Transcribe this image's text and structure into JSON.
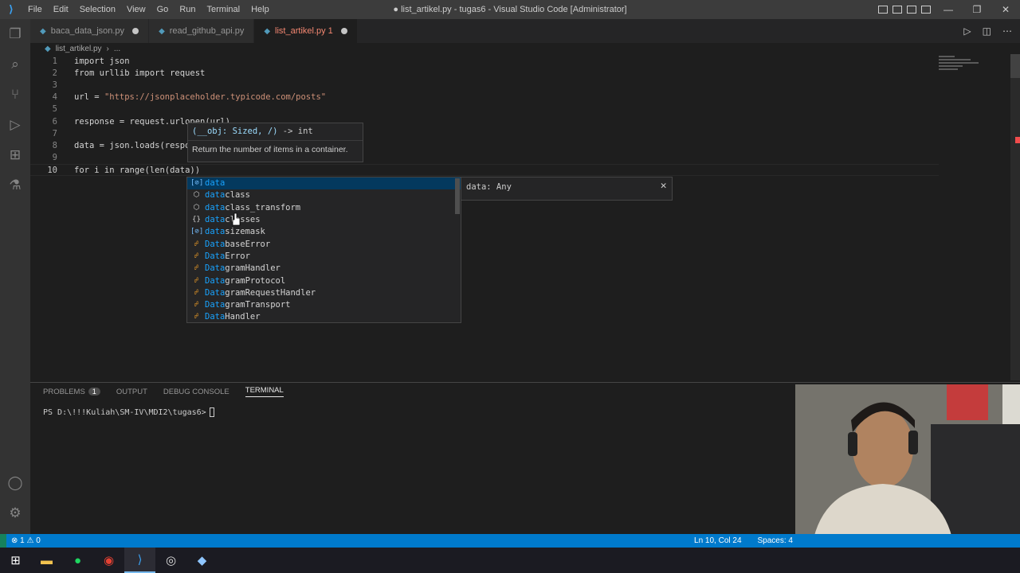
{
  "menu": [
    "File",
    "Edit",
    "Selection",
    "View",
    "Go",
    "Run",
    "Terminal",
    "Help"
  ],
  "window_title": "● list_artikel.py - tugas6 - Visual Studio Code [Administrator]",
  "tabs": [
    {
      "label": "baca_data_json.py"
    },
    {
      "label": "read_github_api.py"
    },
    {
      "label": "list_artikel.py 1"
    }
  ],
  "breadcrumb": {
    "file": "list_artikel.py",
    "more": "..."
  },
  "code_lines": [
    {
      "n": "1",
      "text": "import json"
    },
    {
      "n": "2",
      "text": "from urllib import request"
    },
    {
      "n": "3",
      "text": ""
    },
    {
      "n": "4",
      "pre": "url = ",
      "str": "\"https://jsonplaceholder.typicode.com/posts\""
    },
    {
      "n": "5",
      "text": ""
    },
    {
      "n": "6",
      "text": "response = request.urlopen(url)"
    },
    {
      "n": "7",
      "text": ""
    },
    {
      "n": "8",
      "text": "data = json.loads(respo"
    },
    {
      "n": "9",
      "text": ""
    },
    {
      "n": "10",
      "text": "for i in range(len(data))"
    }
  ],
  "hover": {
    "signature_param": "(__obj: Sized, /)",
    "signature_ret": " -> int",
    "doc": "Return the number of items in a container."
  },
  "suggestions": [
    {
      "kind": "var",
      "match": "data",
      "rest": ""
    },
    {
      "kind": "mod",
      "match": "data",
      "rest": "class"
    },
    {
      "kind": "mod",
      "match": "data",
      "rest": "class_transform"
    },
    {
      "kind": "ns",
      "match": "data",
      "rest": "classes"
    },
    {
      "kind": "var",
      "match": "data",
      "rest": "sizemask"
    },
    {
      "kind": "cls",
      "match": "Data",
      "rest": "baseError"
    },
    {
      "kind": "cls",
      "match": "Data",
      "rest": "Error"
    },
    {
      "kind": "cls",
      "match": "Data",
      "rest": "gramHandler"
    },
    {
      "kind": "cls",
      "match": "Data",
      "rest": "gramProtocol"
    },
    {
      "kind": "cls",
      "match": "Data",
      "rest": "gramRequestHandler"
    },
    {
      "kind": "cls",
      "match": "Data",
      "rest": "gramTransport"
    },
    {
      "kind": "cls",
      "match": "Data",
      "rest": "Handler"
    }
  ],
  "details": {
    "text": "data: Any",
    "close": "✕"
  },
  "panel": {
    "tabs": [
      "PROBLEMS",
      "OUTPUT",
      "DEBUG CONSOLE",
      "TERMINAL"
    ],
    "problems_count": "1",
    "prompt": "PS D:\\!!!Kuliah\\SM-IV\\MDI2\\tugas6>"
  },
  "status": {
    "problems": "⊗ 1  ⚠ 0",
    "position": "Ln 10, Col 24",
    "spaces": "Spaces: 4"
  },
  "colors": {
    "accent": "#007acc",
    "selection": "#04395e",
    "error": "#f48771"
  }
}
